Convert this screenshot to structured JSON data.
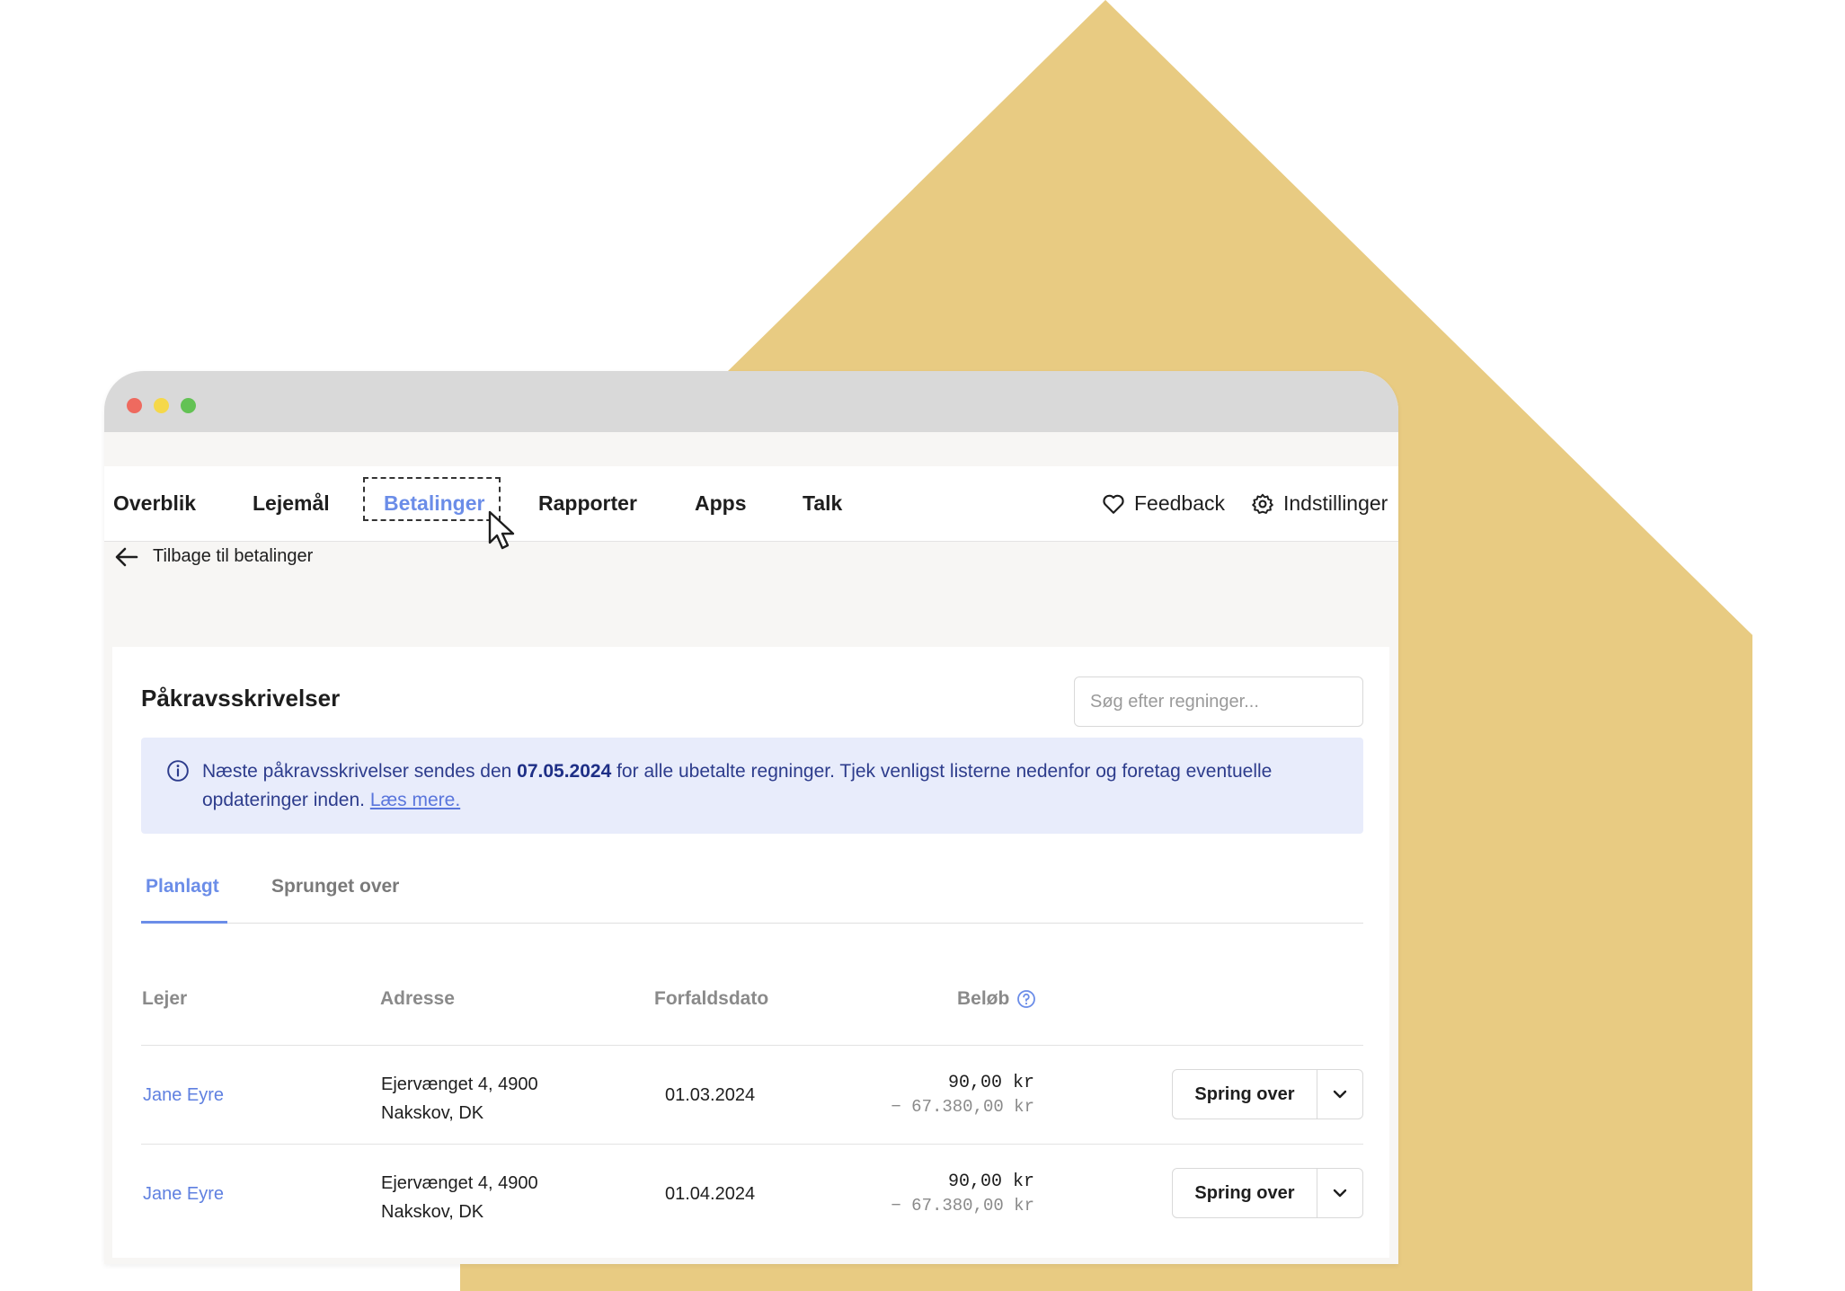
{
  "theme": {
    "accent": "#6b8de8",
    "backdrop": "#e8cb82",
    "info_bg": "#e8ecfb"
  },
  "nav": {
    "items": [
      {
        "label": "Overblik"
      },
      {
        "label": "Lejemål"
      },
      {
        "label": "Betalinger",
        "active": true
      },
      {
        "label": "Rapporter"
      },
      {
        "label": "Apps"
      },
      {
        "label": "Talk"
      }
    ],
    "feedback_label": "Feedback",
    "settings_label": "Indstillinger"
  },
  "back_link": "Tilbage til betalinger",
  "card": {
    "title": "Påkravsskrivelser",
    "search_placeholder": "Søg efter regninger...",
    "info": {
      "text_before": "Næste påkravsskrivelser sendes den ",
      "date": "07.05.2024",
      "text_after": " for alle ubetalte regninger. Tjek venligst listerne nedenfor og foretag eventuelle opdateringer inden. ",
      "link": "Læs mere."
    },
    "tabs": [
      {
        "label": "Planlagt",
        "active": true
      },
      {
        "label": "Sprunget over"
      }
    ],
    "columns": {
      "tenant": "Lejer",
      "address": "Adresse",
      "due_date": "Forfaldsdato",
      "amount": "Beløb"
    },
    "rows": [
      {
        "tenant": "Jane Eyre",
        "address_line1": "Ejervænget 4, 4900",
        "address_line2": "Nakskov, DK",
        "due_date": "01.03.2024",
        "amount": "90,00 kr",
        "balance": "− 67.380,00 kr",
        "action": "Spring over"
      },
      {
        "tenant": "Jane Eyre",
        "address_line1": "Ejervænget 4, 4900",
        "address_line2": "Nakskov, DK",
        "due_date": "01.04.2024",
        "amount": "90,00 kr",
        "balance": "− 67.380,00 kr",
        "action": "Spring over"
      }
    ]
  }
}
